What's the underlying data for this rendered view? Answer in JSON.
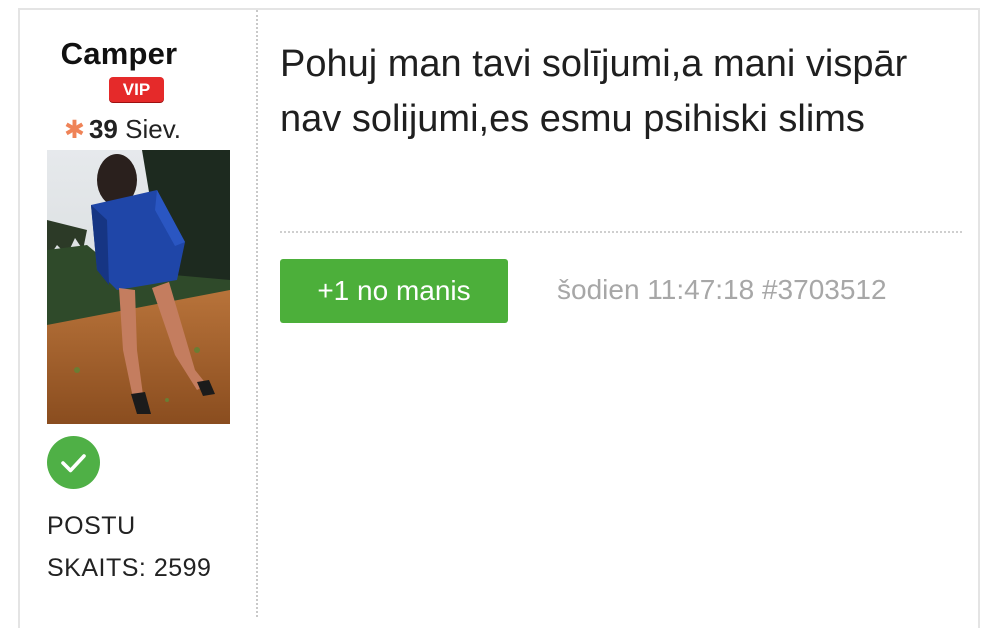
{
  "author": {
    "username": "Camper",
    "vip_badge": "VIP",
    "age": "39",
    "gender": "Siev.",
    "verified_icon": "check-circle-icon",
    "posts_label_line1": "POSTU",
    "posts_label_line2": "SKAITS:",
    "posts_count": "2599"
  },
  "post": {
    "message": "Pohuj man tavi solījumi,a mani vispār nav solijumi,es esmu psihiski slims",
    "plus_button_label": "+1 no manis",
    "timestamp": "šodien 11:47:18",
    "post_id": "#3703512"
  },
  "colors": {
    "vip_red": "#e52a2a",
    "button_green": "#4caf3a",
    "verified_green": "#4fb046",
    "star_orange": "#ef8357",
    "muted_gray": "#a7a7a7"
  }
}
